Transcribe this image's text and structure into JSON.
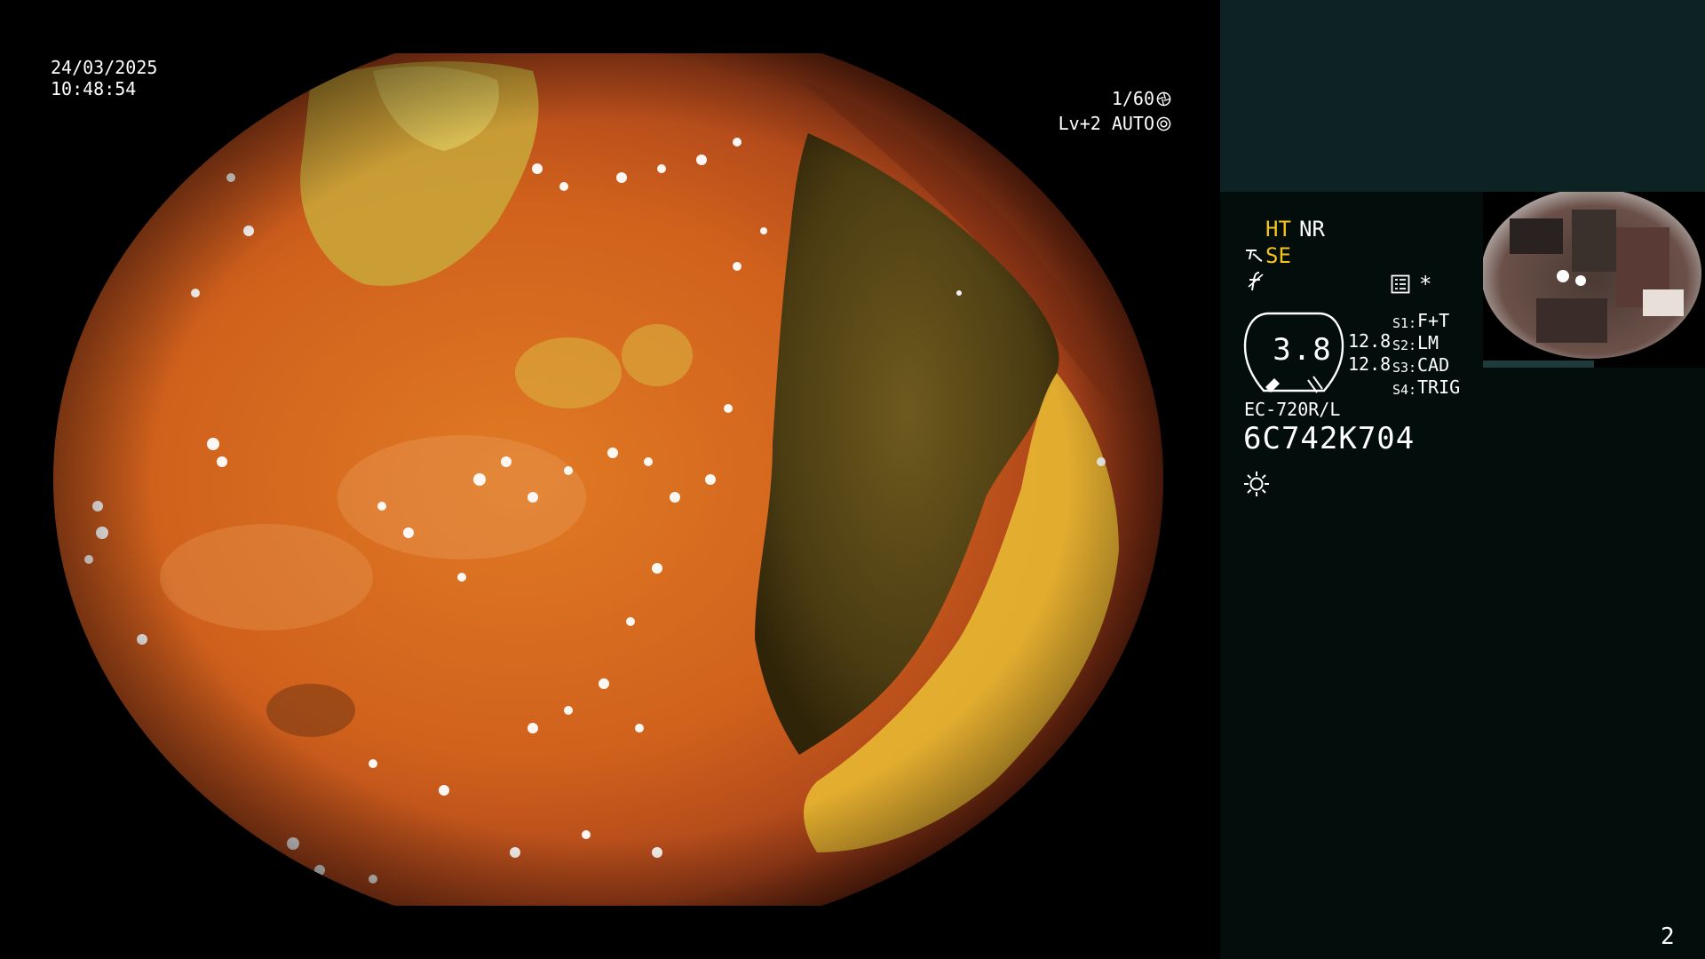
{
  "overlay": {
    "date": "24/03/2025",
    "time": "10:48:54",
    "shutter": "1/60",
    "shutter_icon": "shutter-icon",
    "level": "Lv+2 AUTO",
    "level_icon": "iris-icon"
  },
  "panel": {
    "ht": "HT",
    "nr": "NR",
    "se": "SE",
    "se_icon": "structure-enhance-icon",
    "f_icon": "freeze-icon",
    "menu_icon": "menu-list-icon",
    "star": "*",
    "gauge_value": "3.8",
    "gauge_icon": "zoom-gauge-icon",
    "values": [
      "12.8",
      "12.8"
    ],
    "slots": [
      {
        "key": "S1:",
        "value": "F+T"
      },
      {
        "key": "S2:",
        "value": "LM"
      },
      {
        "key": "S3:",
        "value": "CAD"
      },
      {
        "key": "S4:",
        "value": "TRIG"
      }
    ],
    "scope_model": "EC-720R/L",
    "serial": "6C742K704",
    "light_icon": "light-source-icon",
    "page_number": "2"
  },
  "colors": {
    "panel_bg": "#020d0c",
    "panel_top_bg": "#0d2222",
    "highlight": "#f5c518",
    "mucosa": "#d2691e"
  }
}
